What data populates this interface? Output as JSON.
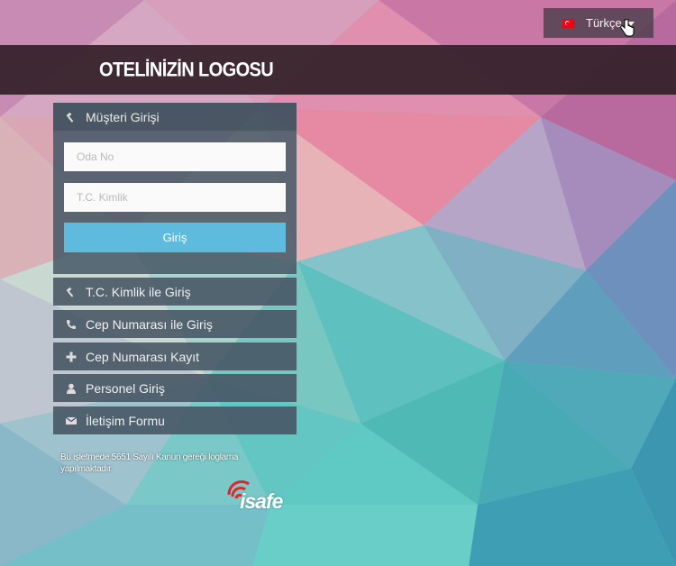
{
  "language": {
    "label": "Türkçe",
    "flag": "turkey-flag-icon"
  },
  "header": {
    "logo_text": "OTELİNİZİN LOGOSU"
  },
  "login": {
    "title": "Müşteri Girişi",
    "icon": "gavel-icon",
    "room_placeholder": "Oda No",
    "id_placeholder": "T.C. Kimlik",
    "submit_label": "Giriş",
    "submit_color": "#5fbbdd"
  },
  "menu": [
    {
      "label": "T.C. Kimlik ile Giriş",
      "icon": "gavel-icon"
    },
    {
      "label": "Cep Numarası ile Giriş",
      "icon": "phone-icon"
    },
    {
      "label": "Cep Numarası Kayıt",
      "icon": "plus-icon"
    },
    {
      "label": "Personel Giriş",
      "icon": "user-icon"
    },
    {
      "label": "İletişim Formu",
      "icon": "envelope-icon"
    }
  ],
  "footer": {
    "legal_text": "Bu işletmede 5651 Sayılı Kanun gereği loglama yapılmaktadır.",
    "brand": "isafe",
    "brand_color": "#e0262d"
  }
}
